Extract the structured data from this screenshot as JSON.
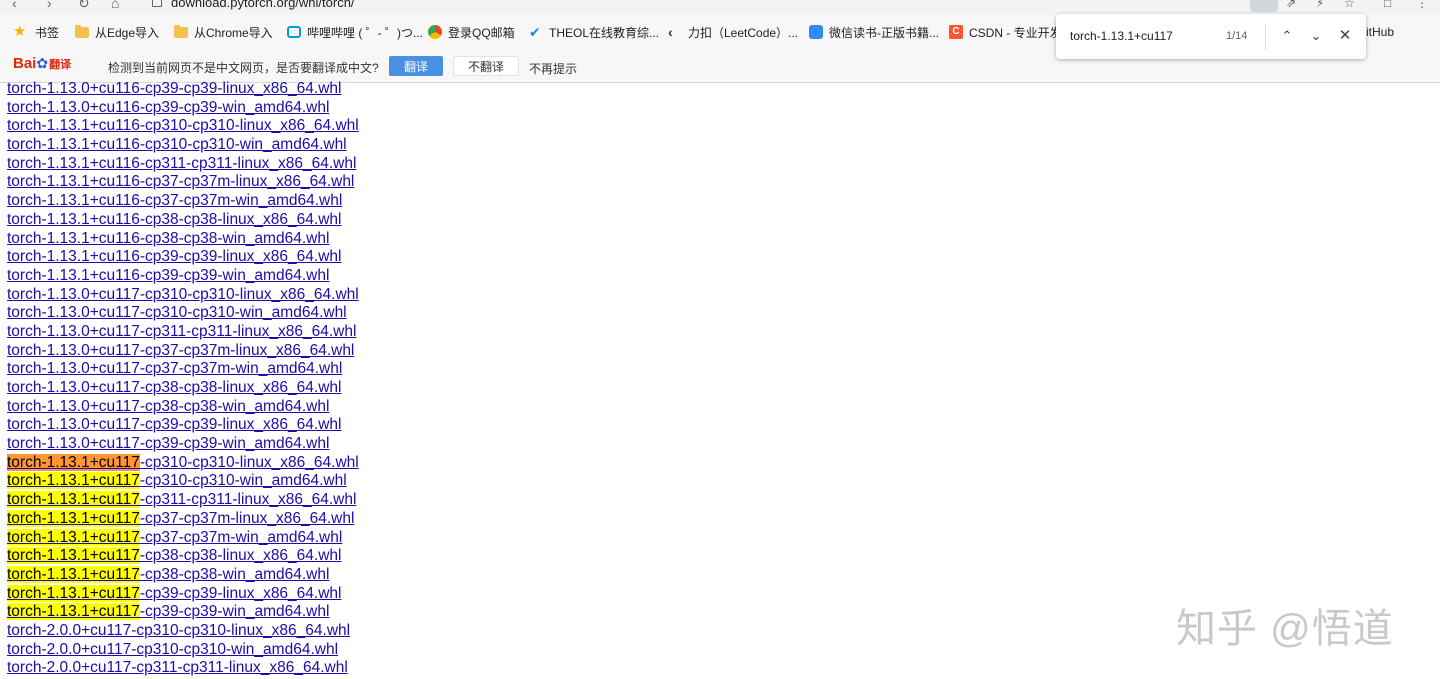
{
  "browser": {
    "url": "download.pytorch.org/whl/torch/"
  },
  "bookmarks": [
    {
      "label": "书签",
      "icon": "star-icon"
    },
    {
      "label": "从Edge导入",
      "icon": "folder-icon"
    },
    {
      "label": "从Chrome导入",
      "icon": "folder-icon"
    },
    {
      "label": "哔哩哔哩 ( ゜- ゜)つ...",
      "icon": "bilibili-icon"
    },
    {
      "label": "登录QQ邮箱",
      "icon": "qqmail-icon"
    },
    {
      "label": "THEOL在线教育综...",
      "icon": "theol-icon"
    },
    {
      "label": "力扣（LeetCode）...",
      "icon": "leetcode-icon"
    },
    {
      "label": "微信读书-正版书籍...",
      "icon": "weread-icon"
    },
    {
      "label": "CSDN - 专业开发",
      "icon": "csdn-icon"
    }
  ],
  "bookmark_overflow_fragment": "itHub",
  "translate_bar": {
    "logo_text": "Bai",
    "logo_suffix": "翻译",
    "message": "检测到当前网页不是中文网页，是否要翻译成中文?",
    "translate_button": "翻译",
    "no_translate_button": "不翻译",
    "never_show": "不再提示"
  },
  "find_bar": {
    "query": "torch-1.13.1+cu117",
    "count": "1/14"
  },
  "files": [
    {
      "pre": "torch-1.13.0+cu116-cp39-cp39-linux_x86_64.whl",
      "match": "",
      "post": "",
      "state": "none"
    },
    {
      "pre": "torch-1.13.0+cu116-cp39-cp39-win_amd64.whl",
      "match": "",
      "post": "",
      "state": "none"
    },
    {
      "pre": "torch-1.13.1+cu116-cp310-cp310-linux_x86_64.whl",
      "match": "",
      "post": "",
      "state": "none"
    },
    {
      "pre": "torch-1.13.1+cu116-cp310-cp310-win_amd64.whl",
      "match": "",
      "post": "",
      "state": "none"
    },
    {
      "pre": "torch-1.13.1+cu116-cp311-cp311-linux_x86_64.whl",
      "match": "",
      "post": "",
      "state": "none"
    },
    {
      "pre": "torch-1.13.1+cu116-cp37-cp37m-linux_x86_64.whl",
      "match": "",
      "post": "",
      "state": "none"
    },
    {
      "pre": "torch-1.13.1+cu116-cp37-cp37m-win_amd64.whl",
      "match": "",
      "post": "",
      "state": "none"
    },
    {
      "pre": "torch-1.13.1+cu116-cp38-cp38-linux_x86_64.whl",
      "match": "",
      "post": "",
      "state": "none"
    },
    {
      "pre": "torch-1.13.1+cu116-cp38-cp38-win_amd64.whl",
      "match": "",
      "post": "",
      "state": "none"
    },
    {
      "pre": "torch-1.13.1+cu116-cp39-cp39-linux_x86_64.whl",
      "match": "",
      "post": "",
      "state": "none"
    },
    {
      "pre": "torch-1.13.1+cu116-cp39-cp39-win_amd64.whl",
      "match": "",
      "post": "",
      "state": "none"
    },
    {
      "pre": "torch-1.13.0+cu117-cp310-cp310-linux_x86_64.whl",
      "match": "",
      "post": "",
      "state": "none"
    },
    {
      "pre": "torch-1.13.0+cu117-cp310-cp310-win_amd64.whl",
      "match": "",
      "post": "",
      "state": "none"
    },
    {
      "pre": "torch-1.13.0+cu117-cp311-cp311-linux_x86_64.whl",
      "match": "",
      "post": "",
      "state": "none"
    },
    {
      "pre": "torch-1.13.0+cu117-cp37-cp37m-linux_x86_64.whl",
      "match": "",
      "post": "",
      "state": "none"
    },
    {
      "pre": "torch-1.13.0+cu117-cp37-cp37m-win_amd64.whl",
      "match": "",
      "post": "",
      "state": "none"
    },
    {
      "pre": "torch-1.13.0+cu117-cp38-cp38-linux_x86_64.whl",
      "match": "",
      "post": "",
      "state": "none"
    },
    {
      "pre": "torch-1.13.0+cu117-cp38-cp38-win_amd64.whl",
      "match": "",
      "post": "",
      "state": "none"
    },
    {
      "pre": "torch-1.13.0+cu117-cp39-cp39-linux_x86_64.whl",
      "match": "",
      "post": "",
      "state": "none"
    },
    {
      "pre": "torch-1.13.0+cu117-cp39-cp39-win_amd64.whl",
      "match": "",
      "post": "",
      "state": "none"
    },
    {
      "pre": "",
      "match": "torch-1.13.1+cu117",
      "post": "-cp310-cp310-linux_x86_64.whl",
      "state": "current"
    },
    {
      "pre": "",
      "match": "torch-1.13.1+cu117",
      "post": "-cp310-cp310-win_amd64.whl",
      "state": "match"
    },
    {
      "pre": "",
      "match": "torch-1.13.1+cu117",
      "post": "-cp311-cp311-linux_x86_64.whl",
      "state": "match"
    },
    {
      "pre": "",
      "match": "torch-1.13.1+cu117",
      "post": "-cp37-cp37m-linux_x86_64.whl",
      "state": "match"
    },
    {
      "pre": "",
      "match": "torch-1.13.1+cu117",
      "post": "-cp37-cp37m-win_amd64.whl",
      "state": "match"
    },
    {
      "pre": "",
      "match": "torch-1.13.1+cu117",
      "post": "-cp38-cp38-linux_x86_64.whl",
      "state": "match"
    },
    {
      "pre": "",
      "match": "torch-1.13.1+cu117",
      "post": "-cp38-cp38-win_amd64.whl",
      "state": "match"
    },
    {
      "pre": "",
      "match": "torch-1.13.1+cu117",
      "post": "-cp39-cp39-linux_x86_64.whl",
      "state": "match"
    },
    {
      "pre": "",
      "match": "torch-1.13.1+cu117",
      "post": "-cp39-cp39-win_amd64.whl",
      "state": "match"
    },
    {
      "pre": "torch-2.0.0+cu117-cp310-cp310-linux_x86_64.whl",
      "match": "",
      "post": "",
      "state": "none"
    },
    {
      "pre": "torch-2.0.0+cu117-cp310-cp310-win_amd64.whl",
      "match": "",
      "post": "",
      "state": "none"
    },
    {
      "pre": "torch-2.0.0+cu117-cp311-cp311-linux_x86_64.whl",
      "match": "",
      "post": "",
      "state": "none"
    }
  ],
  "watermark": "知乎 @悟道",
  "colors": {
    "link": "#1a0dab",
    "match_highlight": "#ffff00",
    "current_match_highlight": "#ff9632",
    "translate_button": "#4a90e2"
  }
}
